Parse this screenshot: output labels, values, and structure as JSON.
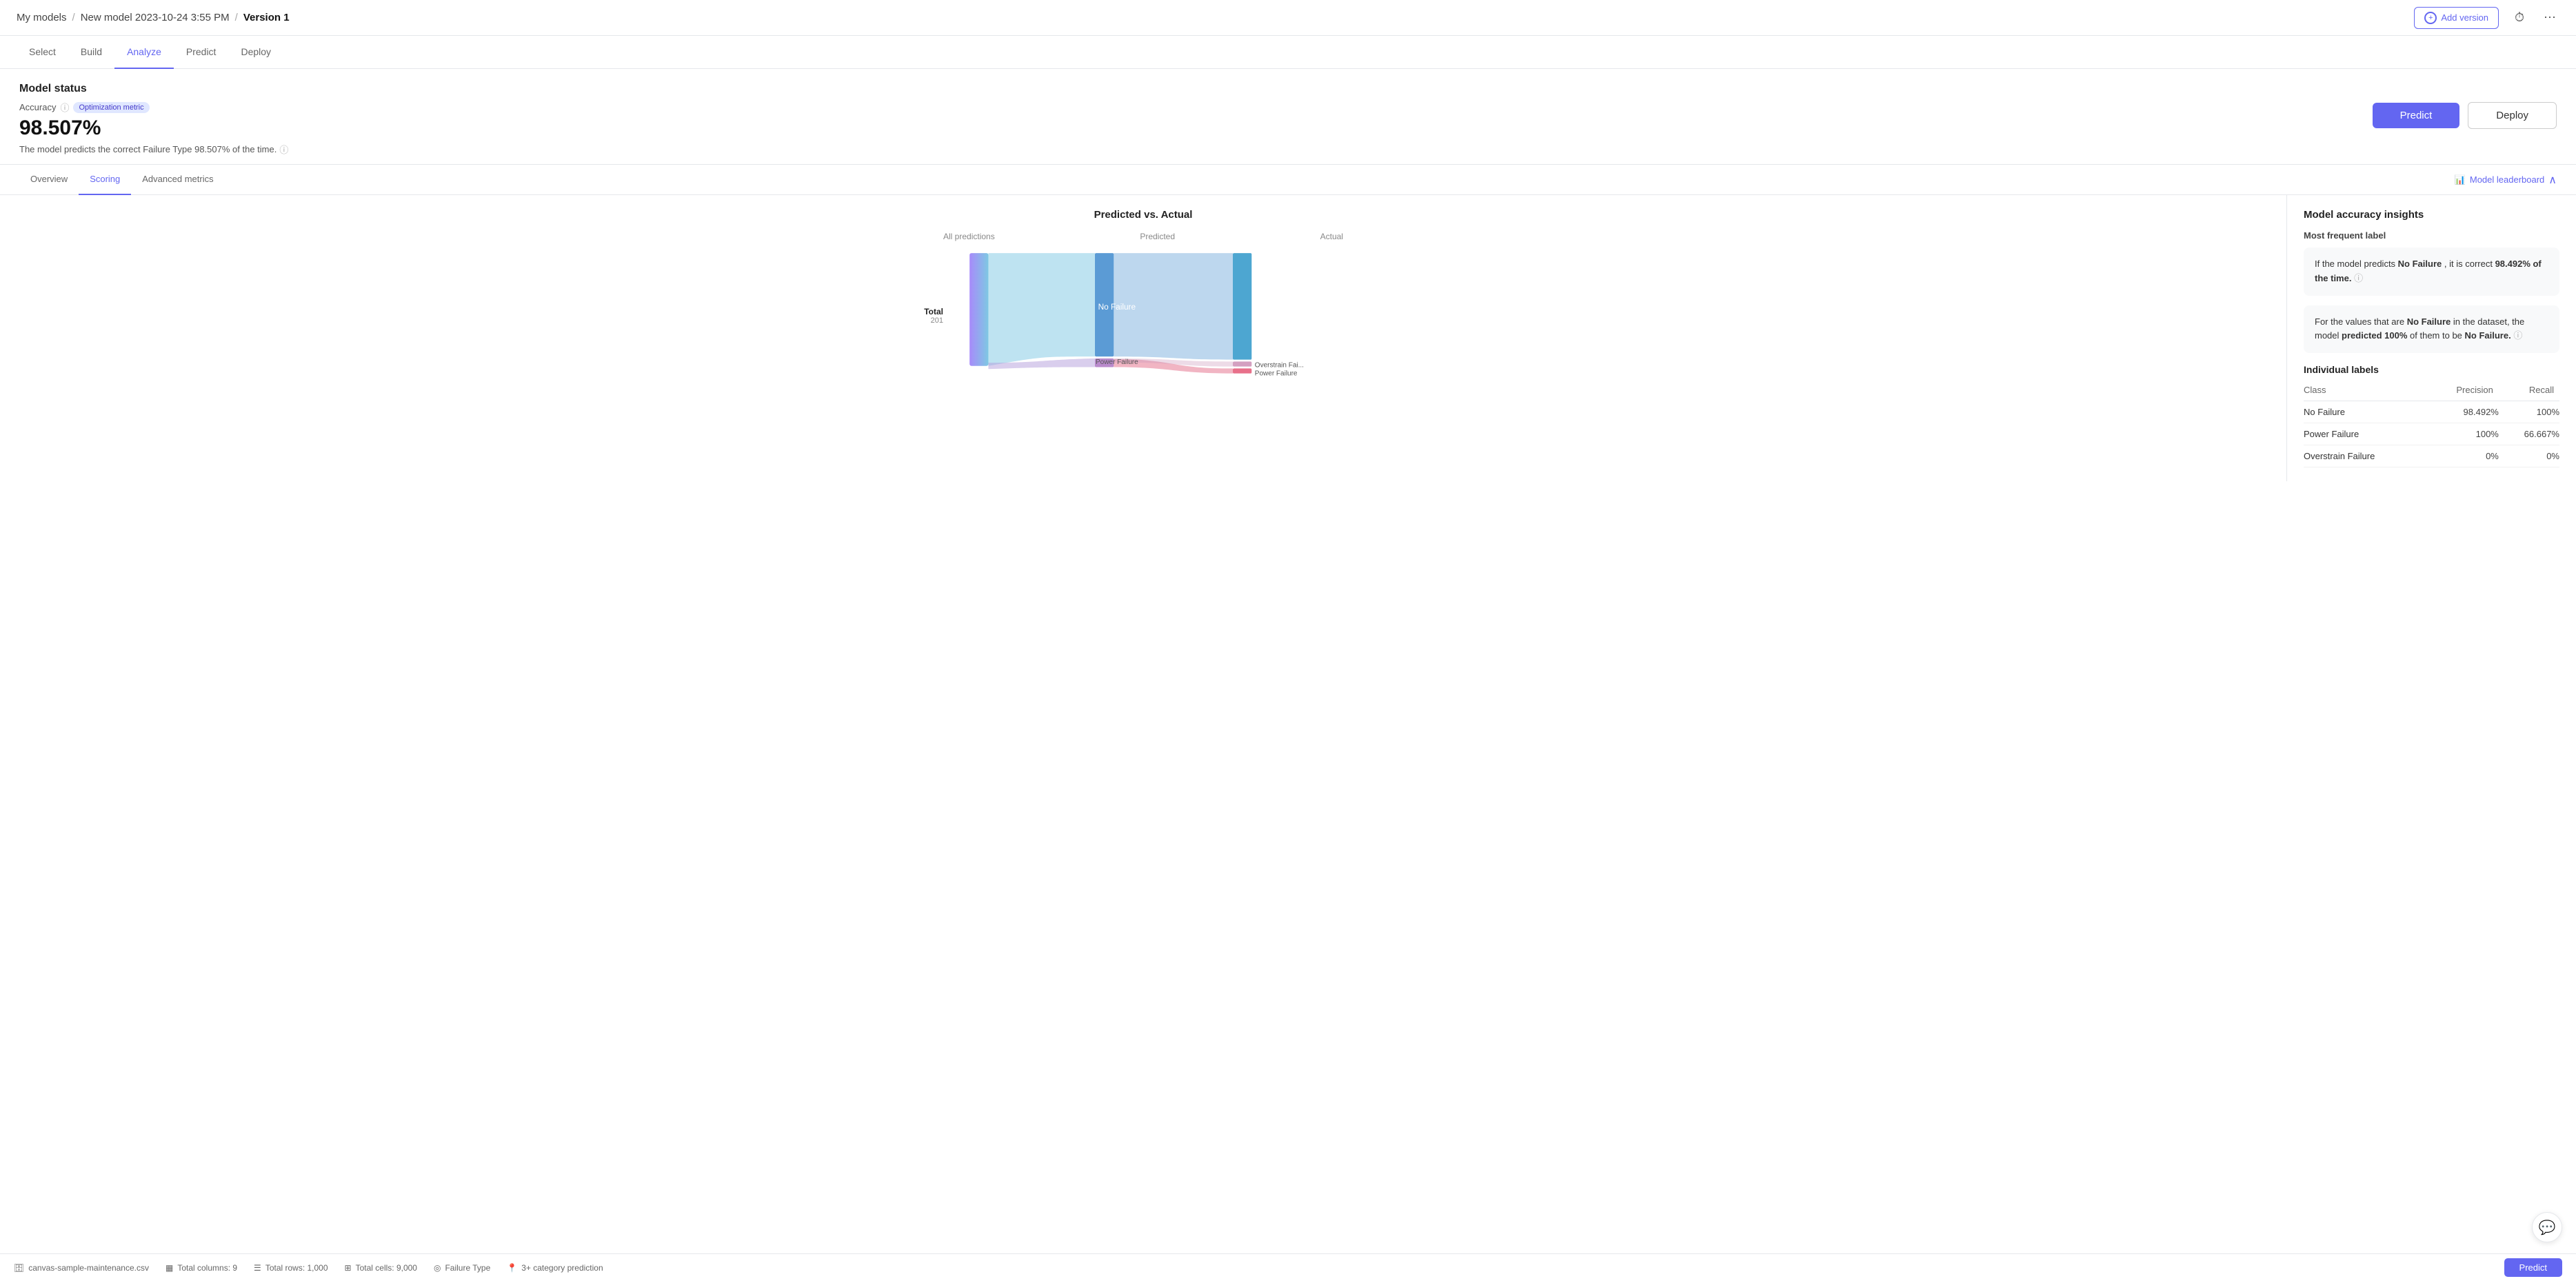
{
  "header": {
    "breadcrumb_my_models": "My models",
    "sep1": "/",
    "breadcrumb_model": "New model 2023-10-24 3:55 PM",
    "sep2": "/",
    "breadcrumb_version": "Version 1",
    "add_version_label": "Add version",
    "history_icon": "⏱",
    "more_icon": "⋯"
  },
  "nav_tabs": [
    {
      "label": "Select",
      "active": false
    },
    {
      "label": "Build",
      "active": false
    },
    {
      "label": "Analyze",
      "active": true
    },
    {
      "label": "Predict",
      "active": false
    },
    {
      "label": "Deploy",
      "active": false
    }
  ],
  "model_status": {
    "title": "Model status",
    "accuracy_label": "Accuracy",
    "info_icon": "ⓘ",
    "optimization_badge": "Optimization metric",
    "accuracy_value": "98.507%",
    "accuracy_desc": "The model predicts the correct Failure Type 98.507% of the time.",
    "desc_info_icon": "ⓘ",
    "btn_predict": "Predict",
    "btn_deploy": "Deploy"
  },
  "sub_tabs": [
    {
      "label": "Overview",
      "active": false
    },
    {
      "label": "Scoring",
      "active": true
    },
    {
      "label": "Advanced metrics",
      "active": false
    }
  ],
  "model_leaderboard": "Model leaderboard",
  "chart": {
    "title": "Predicted vs. Actual",
    "label_all_predictions": "All predictions",
    "label_predicted": "Predicted",
    "label_actual": "Actual",
    "total_label": "Total",
    "total_count": "201",
    "nodes": [
      {
        "id": "all",
        "label": ""
      },
      {
        "id": "pred_no_failure",
        "label": "No Failure"
      },
      {
        "id": "pred_power_failure",
        "label": "Power Failure"
      },
      {
        "id": "actual_no_failure",
        "label": "No Failure"
      },
      {
        "id": "actual_overstrain",
        "label": "Overstrain Fai..."
      },
      {
        "id": "actual_power",
        "label": "Power Failure"
      }
    ]
  },
  "right_panel": {
    "title": "Model accuracy insights",
    "most_frequent_label": "Most frequent label",
    "insight1": {
      "prefix": "If the model predicts ",
      "bold1": "No Failure",
      "middle": ", it is correct ",
      "bold2": "98.492% of the time.",
      "info_icon": "ⓘ"
    },
    "insight2": {
      "prefix": "For the values that are ",
      "bold1": "No Failure",
      "middle": " in the dataset, the model ",
      "bold2": "predicted 100%",
      "suffix": " of them to be ",
      "bold3": "No Failure.",
      "info_icon": "ⓘ"
    },
    "individual_labels_title": "Individual labels",
    "table": {
      "headers": [
        "Class",
        "Precision",
        "Recall"
      ],
      "rows": [
        {
          "class": "No Failure",
          "precision": "98.492%",
          "recall": "100%"
        },
        {
          "class": "Power Failure",
          "precision": "100%",
          "recall": "66.667%"
        },
        {
          "class": "Overstrain Failure",
          "precision": "0%",
          "recall": "0%"
        }
      ]
    }
  },
  "status_bar": {
    "file": "canvas-sample-maintenance.csv",
    "total_columns": "Total columns: 9",
    "total_rows": "Total rows: 1,000",
    "total_cells": "Total cells: 9,000",
    "target": "Failure Type",
    "prediction_type": "3+ category prediction",
    "btn_predict": "Predict"
  },
  "chat_icon": "💬"
}
